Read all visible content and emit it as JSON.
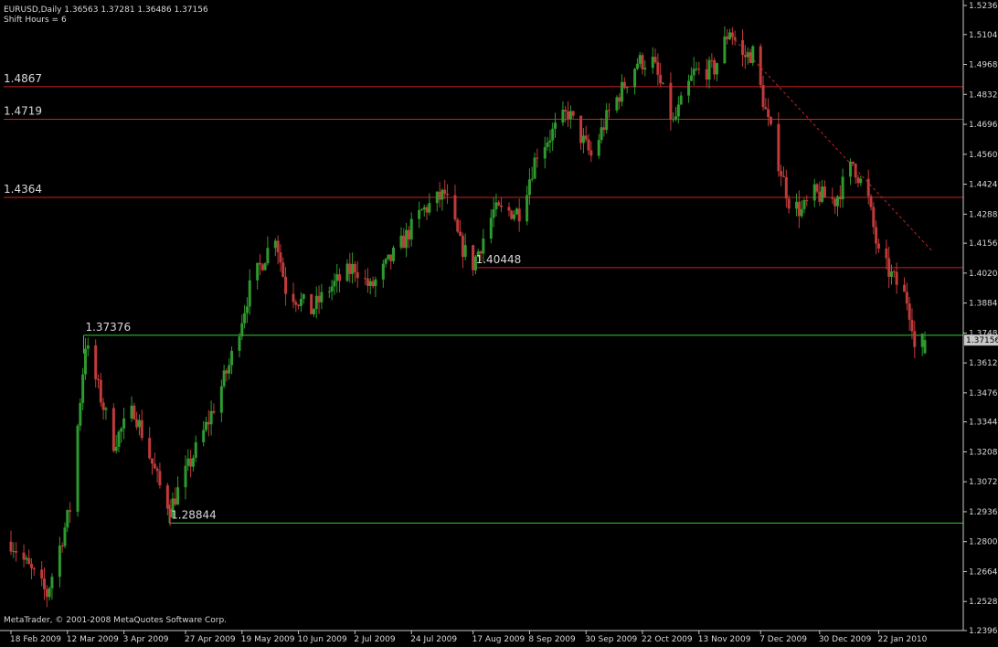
{
  "header": {
    "symbol_line": "EURUSD,Daily  1.36563 1.37281 1.36486 1.37156",
    "indicator_line": "Shift Hours = 6"
  },
  "footer": {
    "copyright": "MetaTrader, © 2001-2008 MetaQuotes Software Corp."
  },
  "colors": {
    "background": "#000000",
    "axis": "#c8c8c8",
    "bull": "#2e9a2e",
    "bear": "#c03a3a",
    "resistance": "#cc2222",
    "support": "#33cc33",
    "price_tag_bg": "#c8c8c8"
  },
  "chart_data": {
    "type": "candlestick",
    "title": "EURUSD,Daily",
    "ylim": [
      1.2396,
      1.5236
    ],
    "y_ticks": [
      "1.52360",
      "1.51040",
      "1.49680",
      "1.48320",
      "1.46960",
      "1.45600",
      "1.44240",
      "1.42880",
      "1.41560",
      "1.40200",
      "1.38840",
      "1.37480",
      "1.36120",
      "1.34760",
      "1.33440",
      "1.32080",
      "1.30720",
      "1.29360",
      "1.28000",
      "1.26640",
      "1.25280",
      "1.23960"
    ],
    "x_ticks": [
      "18 Feb 2009",
      "12 Mar 2009",
      "3 Apr 2009",
      "27 Apr 2009",
      "19 May 2009",
      "10 Jun 2009",
      "2 Jul 2009",
      "24 Jul 2009",
      "17 Aug 2009",
      "8 Sep 2009",
      "30 Sep 2009",
      "22 Oct 2009",
      "13 Nov 2009",
      "7 Dec 2009",
      "30 Dec 2009",
      "22 Jan 2010"
    ],
    "current_price": "1.37156",
    "levels": [
      {
        "label": "1.4867",
        "value": 1.4867,
        "kind": "resistance"
      },
      {
        "label": "1.4719",
        "value": 1.4719,
        "kind": "resistance"
      },
      {
        "label": "1.4364",
        "value": 1.4364,
        "kind": "resistance"
      },
      {
        "label": "1.40448",
        "value": 1.40448,
        "kind": "resistance"
      },
      {
        "label": "1.37376",
        "value": 1.37376,
        "kind": "support"
      },
      {
        "label": "1.28844",
        "value": 1.28844,
        "kind": "support"
      }
    ],
    "trendline": {
      "start": {
        "date": "2009-11-27",
        "value": 1.508
      },
      "end": {
        "date": "2010-01-29",
        "value": 1.409
      },
      "style": "dashed"
    },
    "anchors": [
      [
        "2009-02-18",
        1.28
      ],
      [
        "2009-03-04",
        1.256
      ],
      [
        "2009-03-13",
        1.295
      ],
      [
        "2009-03-19",
        1.37
      ],
      [
        "2009-03-30",
        1.325
      ],
      [
        "2009-04-07",
        1.34
      ],
      [
        "2009-04-17",
        1.305
      ],
      [
        "2009-04-21",
        1.295
      ],
      [
        "2009-05-06",
        1.335
      ],
      [
        "2009-05-14",
        1.36
      ],
      [
        "2009-05-22",
        1.395
      ],
      [
        "2009-06-01",
        1.42
      ],
      [
        "2009-06-05",
        1.395
      ],
      [
        "2009-06-15",
        1.385
      ],
      [
        "2009-06-22",
        1.395
      ],
      [
        "2009-07-02",
        1.405
      ],
      [
        "2009-07-08",
        1.395
      ],
      [
        "2009-07-20",
        1.415
      ],
      [
        "2009-07-28",
        1.43
      ],
      [
        "2009-08-06",
        1.438
      ],
      [
        "2009-08-12",
        1.415
      ],
      [
        "2009-08-17",
        1.406
      ],
      [
        "2009-08-25",
        1.43
      ],
      [
        "2009-09-04",
        1.43
      ],
      [
        "2009-09-11",
        1.457
      ],
      [
        "2009-09-23",
        1.475
      ],
      [
        "2009-10-02",
        1.455
      ],
      [
        "2009-10-09",
        1.475
      ],
      [
        "2009-10-20",
        1.498
      ],
      [
        "2009-10-26",
        1.498
      ],
      [
        "2009-11-03",
        1.47
      ],
      [
        "2009-11-11",
        1.493
      ],
      [
        "2009-11-19",
        1.495
      ],
      [
        "2009-11-25",
        1.513
      ],
      [
        "2009-11-30",
        1.5
      ],
      [
        "2009-12-04",
        1.502
      ],
      [
        "2009-12-10",
        1.47
      ],
      [
        "2009-12-18",
        1.435
      ],
      [
        "2009-12-23",
        1.43
      ],
      [
        "2009-12-28",
        1.438
      ],
      [
        "2010-01-05",
        1.435
      ],
      [
        "2010-01-12",
        1.452
      ],
      [
        "2010-01-18",
        1.435
      ],
      [
        "2010-01-22",
        1.41
      ],
      [
        "2010-01-28",
        1.399
      ],
      [
        "2010-02-02",
        1.39
      ],
      [
        "2010-02-04",
        1.38
      ],
      [
        "2010-02-05",
        1.368
      ],
      [
        "2010-02-09",
        1.3716
      ]
    ]
  }
}
